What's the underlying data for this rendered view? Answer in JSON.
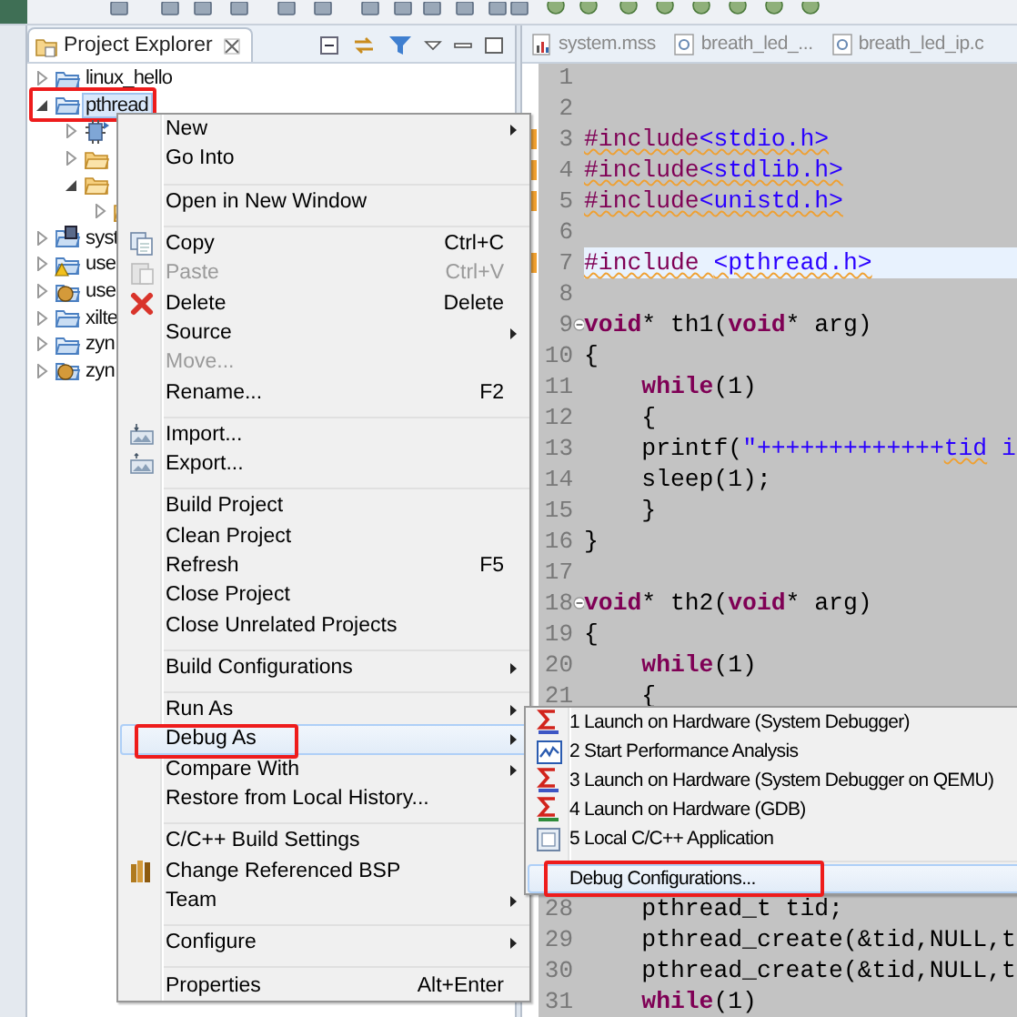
{
  "explorer": {
    "title": "Project Explorer",
    "items": [
      {
        "label": "linux_hello",
        "kind": "project",
        "expanded": false,
        "selected": false
      },
      {
        "label": "pthread",
        "kind": "project",
        "expanded": true,
        "selected": true,
        "annotated": true,
        "children": [
          {
            "kind": "binaries",
            "expanded": false
          },
          {
            "kind": "folder",
            "expanded": false
          },
          {
            "kind": "folder",
            "expanded": true,
            "children": [
              {
                "kind": "folder",
                "expanded": false
              }
            ]
          }
        ]
      },
      {
        "label": "syst",
        "kind": "hw-project",
        "expanded": false,
        "selected": false
      },
      {
        "label": "use",
        "kind": "warning-project",
        "expanded": false,
        "selected": false
      },
      {
        "label": "use",
        "kind": "bsp-project",
        "expanded": false,
        "selected": false
      },
      {
        "label": "xilte",
        "kind": "project",
        "expanded": false,
        "selected": false
      },
      {
        "label": "zyn",
        "kind": "project",
        "expanded": false,
        "selected": false
      },
      {
        "label": "zyn",
        "kind": "bsp-project",
        "expanded": false,
        "selected": false
      }
    ]
  },
  "editor": {
    "tabs": [
      {
        "label": "system.mss",
        "kind": "mss",
        "selected": false
      },
      {
        "label": "breath_led_...",
        "kind": "c",
        "selected": false
      },
      {
        "label": "breath_led_ip.c",
        "kind": "c",
        "selected": false
      }
    ],
    "blocks": [
      {
        "lines": [
          {
            "n": "1",
            "marker": false,
            "fold": false
          },
          {
            "n": "2",
            "marker": false,
            "fold": false
          },
          {
            "n": "3",
            "marker": true,
            "fold": false,
            "segs": [
              {
                "kind": "pp",
                "text": "#include",
                "warning": true
              },
              {
                "kind": "hdr",
                "text": "<stdio.h>",
                "warning": true
              }
            ]
          },
          {
            "n": "4",
            "marker": true,
            "fold": false,
            "segs": [
              {
                "kind": "pp",
                "text": "#include",
                "warning": true
              },
              {
                "kind": "hdr",
                "text": "<stdlib.h>",
                "warning": true
              }
            ]
          },
          {
            "n": "5",
            "marker": true,
            "fold": false,
            "segs": [
              {
                "kind": "pp",
                "text": "#include",
                "warning": true
              },
              {
                "kind": "hdr",
                "text": "<unistd.h>",
                "warning": true
              }
            ]
          },
          {
            "n": "6",
            "marker": false,
            "fold": false
          },
          {
            "n": "7",
            "marker": true,
            "fold": false,
            "current": true,
            "segs": [
              {
                "kind": "pp",
                "text": "#include ",
                "warning": true
              },
              {
                "kind": "hdr",
                "text": "<pthread.h>",
                "warning": true
              }
            ]
          },
          {
            "n": "8",
            "marker": false,
            "fold": false
          },
          {
            "n": "9",
            "marker": false,
            "fold": true,
            "segs": [
              {
                "kind": "kw",
                "text": "void"
              },
              {
                "kind": "plain",
                "text": "* th1("
              },
              {
                "kind": "kw",
                "text": "void"
              },
              {
                "kind": "plain",
                "text": "* arg)"
              }
            ]
          },
          {
            "n": "10",
            "marker": false,
            "fold": false,
            "segs": [
              {
                "kind": "plain",
                "text": "{"
              }
            ]
          },
          {
            "n": "11",
            "marker": false,
            "fold": false,
            "segs": [
              {
                "kind": "kw",
                "text": "    while"
              },
              {
                "kind": "plain",
                "text": "(1)"
              }
            ]
          },
          {
            "n": "12",
            "marker": false,
            "fold": false,
            "segs": [
              {
                "kind": "plain",
                "text": "    {"
              }
            ]
          },
          {
            "n": "13",
            "marker": false,
            "fold": false,
            "segs": [
              {
                "kind": "plain",
                "text": "    printf("
              },
              {
                "kind": "str",
                "text": "\"+++++++++++++"
              },
              {
                "kind": "str",
                "text": "tid",
                "warning": true
              },
              {
                "kind": "str",
                "text": " i"
              }
            ]
          },
          {
            "n": "14",
            "marker": false,
            "fold": false,
            "segs": [
              {
                "kind": "plain",
                "text": "    sleep(1);"
              }
            ]
          },
          {
            "n": "15",
            "marker": false,
            "fold": false,
            "segs": [
              {
                "kind": "plain",
                "text": "    }"
              }
            ]
          },
          {
            "n": "16",
            "marker": false,
            "fold": false,
            "segs": [
              {
                "kind": "plain",
                "text": "}"
              }
            ]
          },
          {
            "n": "17",
            "marker": false,
            "fold": false
          },
          {
            "n": "18",
            "marker": false,
            "fold": true,
            "segs": [
              {
                "kind": "kw",
                "text": "void"
              },
              {
                "kind": "plain",
                "text": "* th2("
              },
              {
                "kind": "kw",
                "text": "void"
              },
              {
                "kind": "plain",
                "text": "* arg)"
              }
            ]
          },
          {
            "n": "19",
            "marker": false,
            "fold": false,
            "segs": [
              {
                "kind": "plain",
                "text": "{"
              }
            ]
          },
          {
            "n": "20",
            "marker": false,
            "fold": false,
            "segs": [
              {
                "kind": "kw",
                "text": "    while"
              },
              {
                "kind": "plain",
                "text": "(1)"
              }
            ]
          },
          {
            "n": "21",
            "marker": false,
            "fold": false,
            "segs": [
              {
                "kind": "plain",
                "text": "    {"
              }
            ]
          }
        ]
      },
      {
        "lines": [
          {
            "n": "28",
            "marker": false,
            "fold": false,
            "segs": [
              {
                "kind": "plain",
                "text": "    pthread_t tid;"
              }
            ]
          },
          {
            "n": "29",
            "marker": false,
            "fold": false,
            "segs": [
              {
                "kind": "plain",
                "text": "    pthread_create(&tid,NULL,t"
              }
            ]
          },
          {
            "n": "30",
            "marker": false,
            "fold": false,
            "segs": [
              {
                "kind": "plain",
                "text": "    pthread_create(&tid,NULL,t"
              }
            ]
          },
          {
            "n": "31",
            "marker": false,
            "fold": false,
            "segs": [
              {
                "kind": "kw",
                "text": "    while"
              },
              {
                "kind": "plain",
                "text": "(1)"
              }
            ]
          }
        ]
      }
    ]
  },
  "context_menu": {
    "items": [
      {
        "kind": "item",
        "label": "New",
        "submenu": true,
        "disabled": false,
        "selected": false
      },
      {
        "kind": "item",
        "label": "Go Into",
        "submenu": false,
        "disabled": false,
        "selected": false
      },
      {
        "kind": "separator"
      },
      {
        "kind": "item",
        "label": "Open in New Window",
        "submenu": false,
        "disabled": false,
        "selected": false
      },
      {
        "kind": "separator"
      },
      {
        "kind": "item",
        "label": "Copy",
        "shortcut": "Ctrl+C",
        "submenu": false,
        "disabled": false,
        "selected": false
      },
      {
        "kind": "item",
        "label": "Paste",
        "shortcut": "Ctrl+V",
        "submenu": false,
        "disabled": true,
        "selected": false
      },
      {
        "kind": "item",
        "label": "Delete",
        "shortcut": "Delete",
        "submenu": false,
        "disabled": false,
        "selected": false
      },
      {
        "kind": "item",
        "label": "Source",
        "submenu": true,
        "disabled": false,
        "selected": false
      },
      {
        "kind": "item",
        "label": "Move...",
        "submenu": false,
        "disabled": true,
        "selected": false
      },
      {
        "kind": "item",
        "label": "Rename...",
        "shortcut": "F2",
        "submenu": false,
        "disabled": false,
        "selected": false
      },
      {
        "kind": "separator"
      },
      {
        "kind": "item",
        "label": "Import...",
        "submenu": false,
        "disabled": false,
        "selected": false
      },
      {
        "kind": "item",
        "label": "Export...",
        "submenu": false,
        "disabled": false,
        "selected": false
      },
      {
        "kind": "separator"
      },
      {
        "kind": "item",
        "label": "Build Project",
        "submenu": false,
        "disabled": false,
        "selected": false
      },
      {
        "kind": "item",
        "label": "Clean Project",
        "submenu": false,
        "disabled": false,
        "selected": false
      },
      {
        "kind": "item",
        "label": "Refresh",
        "shortcut": "F5",
        "submenu": false,
        "disabled": false,
        "selected": false
      },
      {
        "kind": "item",
        "label": "Close Project",
        "submenu": false,
        "disabled": false,
        "selected": false
      },
      {
        "kind": "item",
        "label": "Close Unrelated Projects",
        "submenu": false,
        "disabled": false,
        "selected": false
      },
      {
        "kind": "separator"
      },
      {
        "kind": "item",
        "label": "Build Configurations",
        "submenu": true,
        "disabled": false,
        "selected": false
      },
      {
        "kind": "separator"
      },
      {
        "kind": "item",
        "label": "Run As",
        "submenu": true,
        "disabled": false,
        "selected": false
      },
      {
        "kind": "item",
        "label": "Debug As",
        "submenu": true,
        "disabled": false,
        "selected": true,
        "annotated": true
      },
      {
        "kind": "item",
        "label": "Compare With",
        "submenu": true,
        "disabled": false,
        "selected": false
      },
      {
        "kind": "item",
        "label": "Restore from Local History...",
        "submenu": false,
        "disabled": false,
        "selected": false
      },
      {
        "kind": "separator"
      },
      {
        "kind": "item",
        "label": "C/C++ Build Settings",
        "submenu": false,
        "disabled": false,
        "selected": false
      },
      {
        "kind": "item",
        "label": "Change Referenced BSP",
        "submenu": false,
        "disabled": false,
        "selected": false
      },
      {
        "kind": "item",
        "label": "Team",
        "submenu": true,
        "disabled": false,
        "selected": false
      },
      {
        "kind": "separator"
      },
      {
        "kind": "item",
        "label": "Configure",
        "submenu": true,
        "disabled": false,
        "selected": false
      },
      {
        "kind": "separator"
      },
      {
        "kind": "item",
        "label": "Properties",
        "shortcut": "Alt+Enter",
        "submenu": false,
        "disabled": false,
        "selected": false
      }
    ]
  },
  "debug_submenu": {
    "items": [
      {
        "kind": "item",
        "label": "1 Launch on Hardware (System Debugger)",
        "selected": false
      },
      {
        "kind": "item",
        "label": "2 Start Performance Analysis",
        "selected": false
      },
      {
        "kind": "item",
        "label": "3 Launch on Hardware (System Debugger on QEMU)",
        "selected": false
      },
      {
        "kind": "item",
        "label": "4 Launch on Hardware (GDB)",
        "selected": false
      },
      {
        "kind": "item",
        "label": "5 Local C/C++ Application",
        "selected": false
      },
      {
        "kind": "separator"
      },
      {
        "kind": "item",
        "label": "Debug Configurations...",
        "selected": true,
        "annotated": true
      }
    ]
  }
}
